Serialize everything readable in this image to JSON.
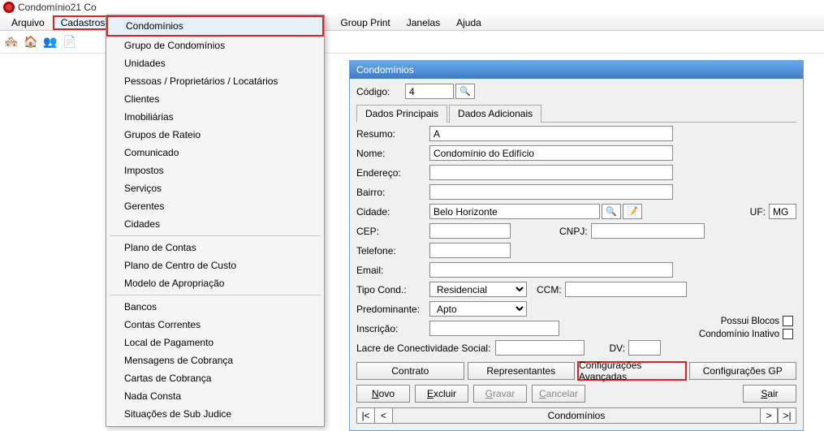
{
  "window": {
    "title": "Condomínio21 Co"
  },
  "menubar": {
    "items": [
      "Arquivo",
      "Cadastros",
      "",
      "Group Print",
      "Janelas",
      "Ajuda"
    ],
    "highlight_index": 1
  },
  "dropdown": {
    "highlight": "Condomínios",
    "groups": [
      [
        "Grupo de Condomínios",
        "Unidades",
        "Pessoas / Proprietários / Locatários",
        "Clientes",
        "Imobiliárias",
        "Grupos de Rateio",
        "Comunicado",
        "Impostos",
        "Serviços",
        "Gerentes",
        "Cidades"
      ],
      [
        "Plano de Contas",
        "Plano de Centro de Custo",
        "Modelo de Apropriação"
      ],
      [
        "Bancos",
        "Contas Correntes",
        "Local de Pagamento",
        "Mensagens de Cobrança",
        "Cartas de Cobrança",
        "Nada Consta",
        "Situações de Sub Judice"
      ]
    ]
  },
  "child": {
    "title": "Condomínios",
    "codigo_label": "Código:",
    "codigo_value": "4",
    "tabs": {
      "t1": "Dados Principais",
      "t2": "Dados Adicionais"
    },
    "fields": {
      "resumo_label": "Resumo:",
      "resumo_value": "A",
      "nome_label": "Nome:",
      "nome_value": "Condomínio do Edifício",
      "endereco_label": "Endereço:",
      "endereco_value": "",
      "bairro_label": "Bairro:",
      "bairro_value": "",
      "cidade_label": "Cidade:",
      "cidade_value": "Belo Horizonte",
      "uf_label": "UF:",
      "uf_value": "MG",
      "cep_label": "CEP:",
      "cep_value": "",
      "cnpj_label": "CNPJ:",
      "cnpj_value": "",
      "telefone_label": "Telefone:",
      "telefone_value": "",
      "email_label": "Email:",
      "email_value": "",
      "tipo_label": "Tipo Cond.:",
      "tipo_value": "Residencial",
      "ccm_label": "CCM:",
      "ccm_value": "",
      "predominante_label": "Predominante:",
      "predominante_value": "Apto",
      "inscricao_label": "Inscrição:",
      "inscricao_value": "",
      "lacre_label": "Lacre de Conectividade Social:",
      "lacre_value": "",
      "dv_label": "DV:",
      "dv_value": ""
    },
    "checks": {
      "c1": "Possui Blocos",
      "c2": "Condomínio Inativo"
    },
    "buttons1": {
      "b1": "Contrato",
      "b2": "Representantes",
      "b3": "Configurações Avançadas",
      "b4": "Configurações GP"
    },
    "buttons2": {
      "novo": "Novo",
      "excluir": "Excluir",
      "gravar": "Gravar",
      "cancelar": "Cancelar",
      "sair": "Sair"
    },
    "nav": {
      "first": "|<",
      "prev": "<",
      "title": "Condomínios",
      "next": ">",
      "last": ">|"
    }
  }
}
